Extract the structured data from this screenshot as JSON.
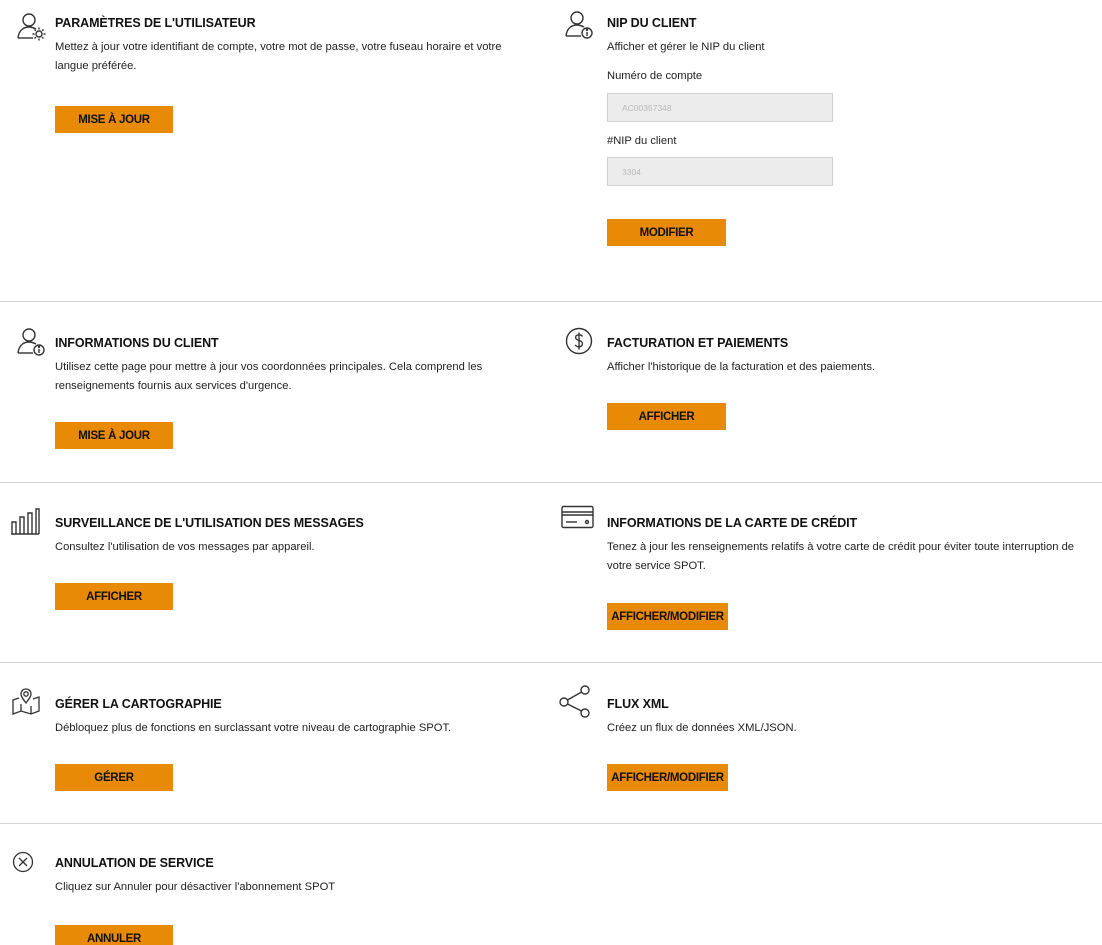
{
  "user_settings": {
    "icon": "user-gear-icon",
    "title": "PARAMÈTRES DE L'UTILISATEUR",
    "description": "Mettez à jour votre identifiant de compte, votre mot de passe, votre fuseau horaire et votre langue préférée.",
    "button": "MISE À JOUR"
  },
  "client_pin": {
    "icon": "user-info-icon",
    "title": "NIP DU CLIENT",
    "description": "Afficher et gérer le NIP du client",
    "account_label": "Numéro de compte",
    "account_value": "AC00357348",
    "pin_label": "#NIP du client",
    "pin_value": "3304",
    "button": "MODIFIER"
  },
  "client_info": {
    "icon": "user-info-icon",
    "title": "INFORMATIONS DU CLIENT",
    "description": "Utilisez cette page pour mettre à jour vos coordonnées principales. Cela comprend les renseignements fournis aux services d'urgence.",
    "button": "MISE À JOUR"
  },
  "billing": {
    "icon": "dollar-circle-icon",
    "title": "FACTURATION ET PAIEMENTS",
    "description": "Afficher l'historique de la facturation et des paiements.",
    "button": "AFFICHER"
  },
  "message_usage": {
    "icon": "bar-chart-icon",
    "title": "SURVEILLANCE DE L'UTILISATION DES MESSAGES",
    "description": "Consultez l'utilisation de vos messages par appareil.",
    "button": "AFFICHER"
  },
  "credit_card": {
    "icon": "credit-card-icon",
    "title": "INFORMATIONS DE LA CARTE DE CRÉDIT",
    "description": "Tenez à jour les renseignements relatifs à votre carte de crédit pour éviter toute interruption de votre service SPOT.",
    "button": "AFFICHER/MODIFIER"
  },
  "mapping": {
    "icon": "map-pin-icon",
    "title": "GÉRER LA CARTOGRAPHIE",
    "description": "Débloquez plus de fonctions en surclassant votre niveau de cartographie SPOT.",
    "button": "GÉRER"
  },
  "xml_feed": {
    "icon": "share-icon",
    "title": "FLUX XML",
    "description": "Créez un flux de données XML/JSON.",
    "button": "AFFICHER/MODIFIER"
  },
  "cancel_service": {
    "icon": "close-circle-icon",
    "title": "ANNULATION DE SERVICE",
    "description": "Cliquez sur Annuler pour désactiver l'abonnement SPOT",
    "button": "ANNULER"
  },
  "colors": {
    "accent": "#e88a06",
    "divider": "#d4d4d4",
    "field_bg": "#ececec"
  }
}
